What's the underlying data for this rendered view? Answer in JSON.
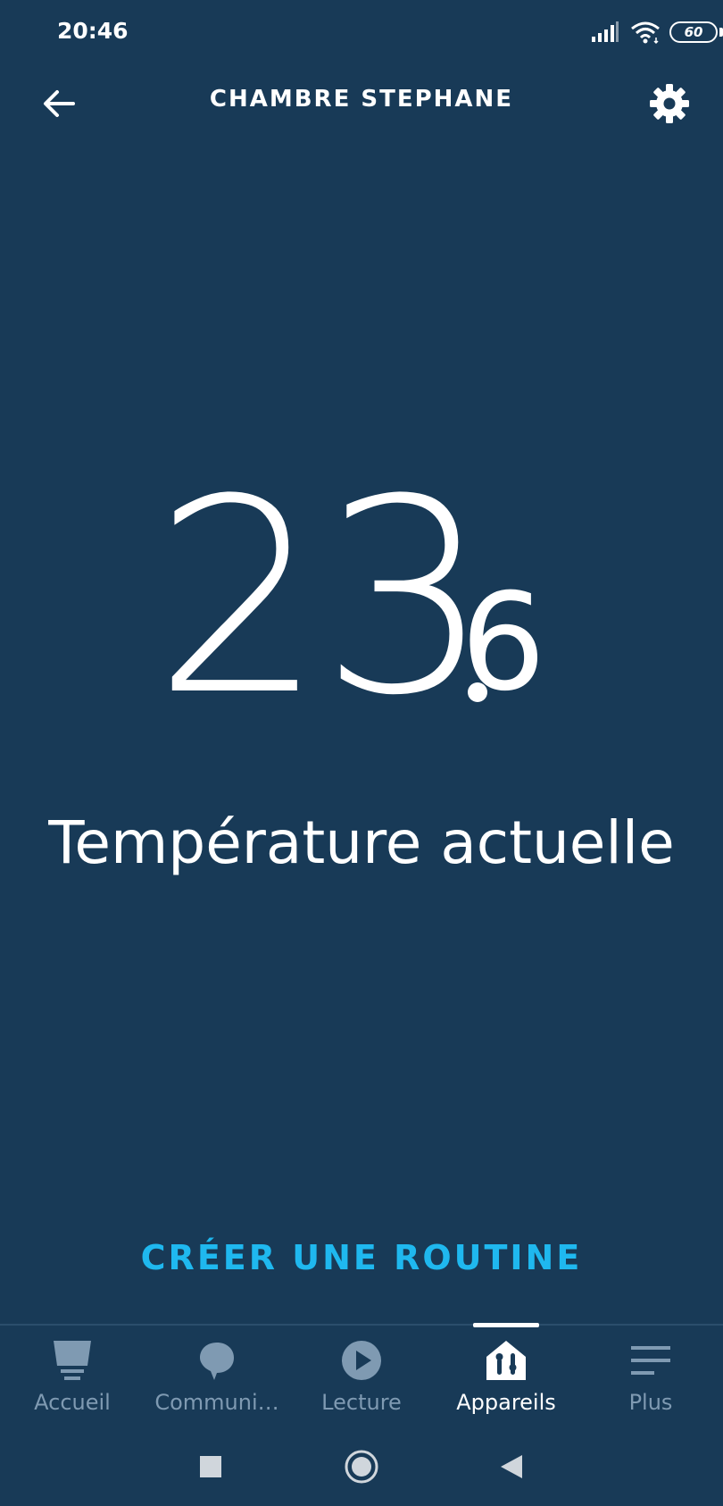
{
  "status_bar": {
    "time": "20:46",
    "battery": "60"
  },
  "header": {
    "title": "CHAMBRE STEPHANE"
  },
  "temperature": {
    "integer_part": "23",
    "decimal_part": "6",
    "label": "Température actuelle"
  },
  "routine": {
    "label": "CRÉER UNE ROUTINE"
  },
  "bottom_nav": {
    "items": [
      {
        "label": "Accueil",
        "icon": "home-icon",
        "active": false
      },
      {
        "label": "Communi…",
        "icon": "communicate-icon",
        "active": false
      },
      {
        "label": "Lecture",
        "icon": "play-icon",
        "active": false
      },
      {
        "label": "Appareils",
        "icon": "devices-icon",
        "active": true
      },
      {
        "label": "Plus",
        "icon": "menu-icon",
        "active": false
      }
    ]
  },
  "colors": {
    "background": "#183a57",
    "accent": "#1fb8ef",
    "inactive": "#7f9ab2",
    "text": "#ffffff"
  }
}
